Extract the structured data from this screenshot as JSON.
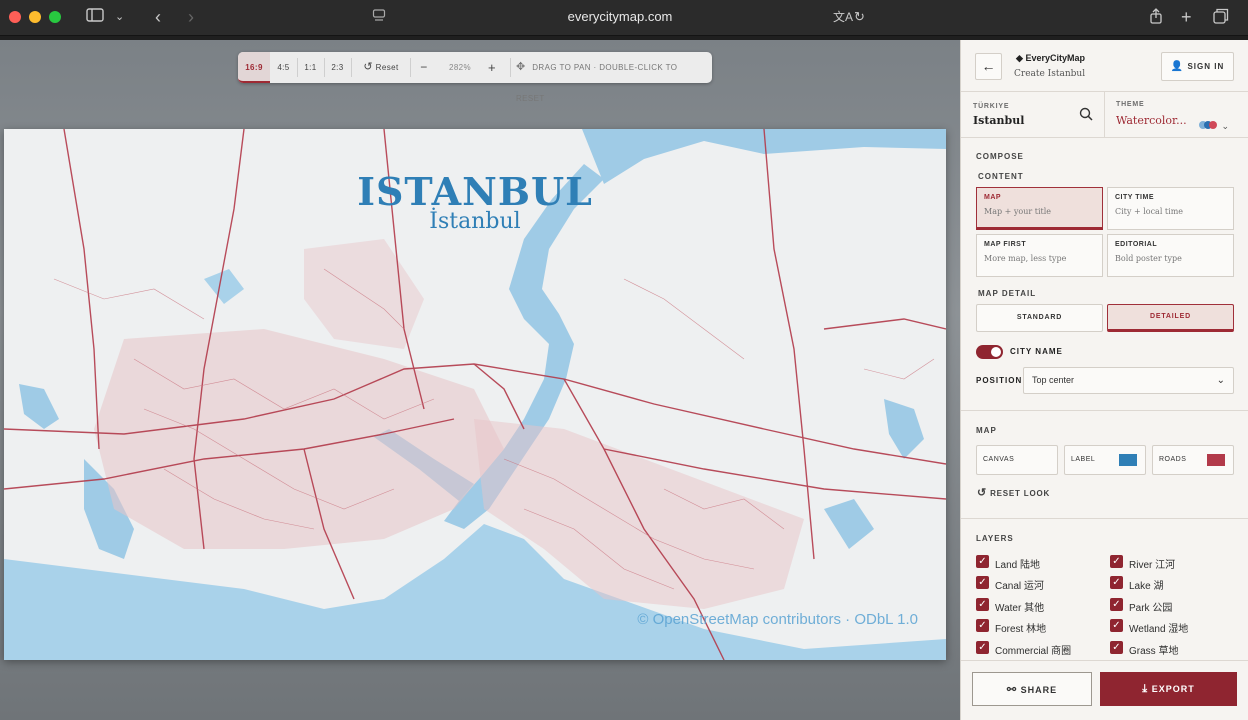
{
  "browser": {
    "url": "everycitymap.com",
    "icons": [
      "sidebar-icon",
      "chevron-down-icon",
      "back-icon",
      "forward-icon",
      "reader-icon",
      "translate-icon",
      "reload-icon",
      "share-icon",
      "new-tab-icon",
      "tabs-icon"
    ]
  },
  "toolbar": {
    "ratios": [
      "16:9",
      "4:5",
      "1:1",
      "2:3"
    ],
    "active_ratio": "16:9",
    "reset_label": "Reset",
    "zoom_out": "−",
    "zoom_value": "282%",
    "zoom_in": "+",
    "hint": "DRAG TO PAN · DOUBLE-CLICK TO RESET"
  },
  "map": {
    "title": "ISTANBUL",
    "subtitle": "İstanbul",
    "attribution": "© OpenStreetMap contributors · ODbL 1.0",
    "colors": {
      "land": "#eef0f1",
      "water": "#9fcbe6",
      "roads": "#b23a4a",
      "title": "#2f7fb6"
    }
  },
  "sidebar": {
    "brand": "EveryCityMap",
    "subtitle": "Create Istanbul",
    "sign_in": "SIGN IN",
    "location": {
      "label": "TÜRKIYE",
      "value": "Istanbul"
    },
    "theme": {
      "label": "THEME",
      "value": "Watercolor...",
      "dots": [
        "#7fb0d8",
        "#2b6fb0",
        "#d04858"
      ]
    },
    "compose_label": "COMPOSE",
    "content_label": "CONTENT",
    "content_cards": [
      {
        "title": "MAP",
        "subtitle": "Map + your title",
        "selected": true
      },
      {
        "title": "CITY TIME",
        "subtitle": "City + local time",
        "selected": false
      },
      {
        "title": "MAP FIRST",
        "subtitle": "More map, less type",
        "selected": false
      },
      {
        "title": "EDITORIAL",
        "subtitle": "Bold poster type",
        "selected": false
      }
    ],
    "map_detail_label": "MAP DETAIL",
    "detail_options": [
      {
        "label": "STANDARD",
        "selected": false
      },
      {
        "label": "DETAILED",
        "selected": true
      }
    ],
    "city_name_label": "CITY NAME",
    "city_name_on": true,
    "position_label": "POSITION",
    "position_value": "Top center",
    "map_label": "MAP",
    "color_fields": [
      {
        "label": "CANVAS",
        "color": ""
      },
      {
        "label": "LABEL",
        "color": "#2f7fb6"
      },
      {
        "label": "ROADS",
        "color": "#b23a4a"
      }
    ],
    "reset_look": "RESET LOOK",
    "layers_label": "LAYERS",
    "layers": [
      {
        "label": "Land 陆地",
        "checked": true
      },
      {
        "label": "River 江河",
        "checked": true
      },
      {
        "label": "Canal 运河",
        "checked": true
      },
      {
        "label": "Lake 湖",
        "checked": true
      },
      {
        "label": "Water 其他",
        "checked": true
      },
      {
        "label": "Park 公园",
        "checked": true
      },
      {
        "label": "Forest 林地",
        "checked": true
      },
      {
        "label": "Wetland 湿地",
        "checked": true
      },
      {
        "label": "Commercial 商圈",
        "checked": true
      },
      {
        "label": "Grass 草地",
        "checked": true
      }
    ],
    "share_label": "SHARE",
    "export_label": "EXPORT"
  }
}
